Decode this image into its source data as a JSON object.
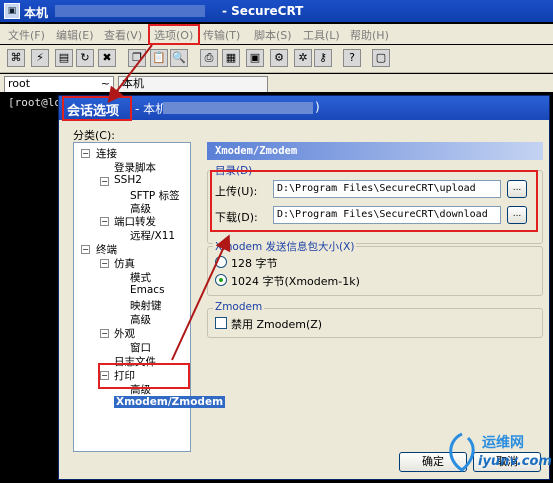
{
  "window": {
    "title_prefix": "本机",
    "title_app": "- SecureCRT"
  },
  "menu": [
    "文件(F)",
    "编辑(E)",
    "查看(V)",
    "选项(O)",
    "传输(T)",
    "脚本(S)",
    "工具(L)",
    "帮助(H)"
  ],
  "tabs": {
    "tab1": "root",
    "tab1_suffix": "~",
    "tab2": "本机"
  },
  "terminal": {
    "line": "[root@lo"
  },
  "dialog": {
    "title": "会话选项",
    "title_suffix": "- 本机",
    "title_end": ")",
    "category_label": "分类(C):",
    "tree": [
      "连接",
      "登录脚本",
      "SSH2",
      "SFTP 标签",
      "高级",
      "端口转发",
      "远程/X11",
      "终端",
      "仿真",
      "模式",
      "Emacs",
      "映射键",
      "高级",
      "外观",
      "窗口",
      "日志文件",
      "打印",
      "高级",
      "Xmodem/Zmodem"
    ],
    "panel_title": "Xmodem/Zmodem",
    "dir_group": "目录(D)",
    "upload_label": "上传(U):",
    "upload_path": "D:\\Program Files\\SecureCRT\\upload",
    "download_label": "下载(D):",
    "download_path": "D:\\Program Files\\SecureCRT\\download",
    "browse": "...",
    "packet_group": "Xmodem 发送信息包大小(X)",
    "radio_128": "128 字节",
    "radio_1024": "1024 字节(Xmodem-1k)",
    "zmodem_group": "Zmodem",
    "disable_zmodem": "禁用 Zmodem(Z)",
    "ok": "确定",
    "cancel": "取消"
  },
  "watermark": {
    "name": "运维网",
    "url": "iyunv.com"
  },
  "colors": {
    "accent": "#e02020",
    "selection": "#316ac5"
  }
}
